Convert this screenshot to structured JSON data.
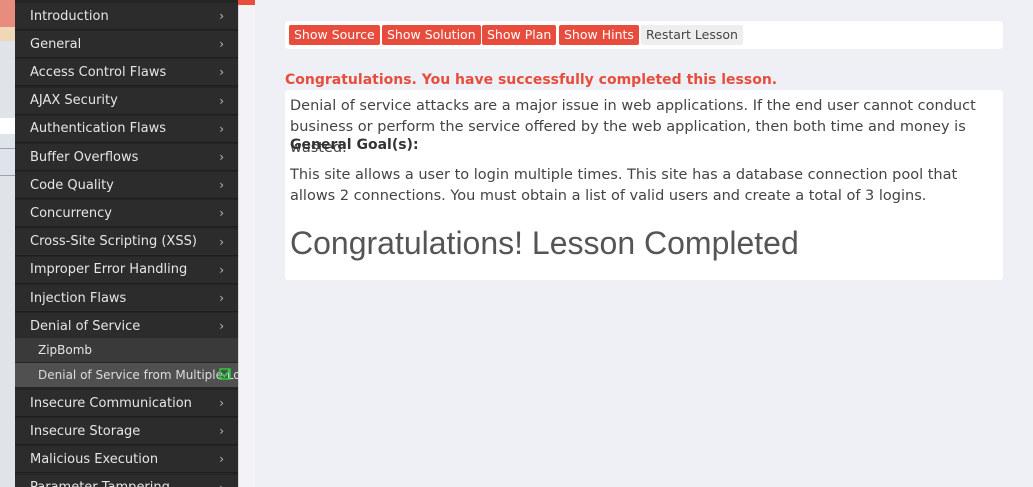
{
  "sidebar": {
    "categories_top": [
      {
        "label": "Introduction"
      },
      {
        "label": "General"
      },
      {
        "label": "Access Control Flaws"
      },
      {
        "label": "AJAX Security"
      },
      {
        "label": "Authentication Flaws"
      },
      {
        "label": "Buffer Overflows"
      },
      {
        "label": "Code Quality"
      },
      {
        "label": "Concurrency"
      },
      {
        "label": "Cross-Site Scripting (XSS)"
      },
      {
        "label": "Improper Error Handling"
      },
      {
        "label": "Injection Flaws"
      },
      {
        "label": "Denial of Service"
      }
    ],
    "lessons": [
      {
        "label": "ZipBomb"
      },
      {
        "label": "Denial of Service from Multiple Logins",
        "completed": true
      }
    ],
    "categories_bottom": [
      {
        "label": "Insecure Communication"
      },
      {
        "label": "Insecure Storage"
      },
      {
        "label": "Malicious Execution"
      },
      {
        "label": "Parameter Tampering"
      }
    ],
    "chevron": "›"
  },
  "toolbar": {
    "show_source": "Show Source",
    "show_solution": "Show Solution",
    "show_plan": "Show Plan",
    "show_hints": "Show Hints",
    "restart_lesson": "Restart Lesson"
  },
  "main": {
    "congrats_message": "Congratulations. You have successfully completed this lesson.",
    "intro": "Denial of service attacks are a major issue in web applications. If the end user cannot conduct business or perform the service offered by the web application, then both time and money is wasted.",
    "goal_heading": "General Goal(s):",
    "goal_text": "This site allows a user to login multiple times. This site has a database connection pool that allows 2 connections. You must obtain a list of valid users and create a total of 3 logins.",
    "completed_heading": "Congratulations! Lesson Completed"
  },
  "colors": {
    "accent": "#e74c3c",
    "sidebar_bg": "#2c2c2c",
    "page_bg": "#eff0f5",
    "check": "#2ecc40"
  }
}
